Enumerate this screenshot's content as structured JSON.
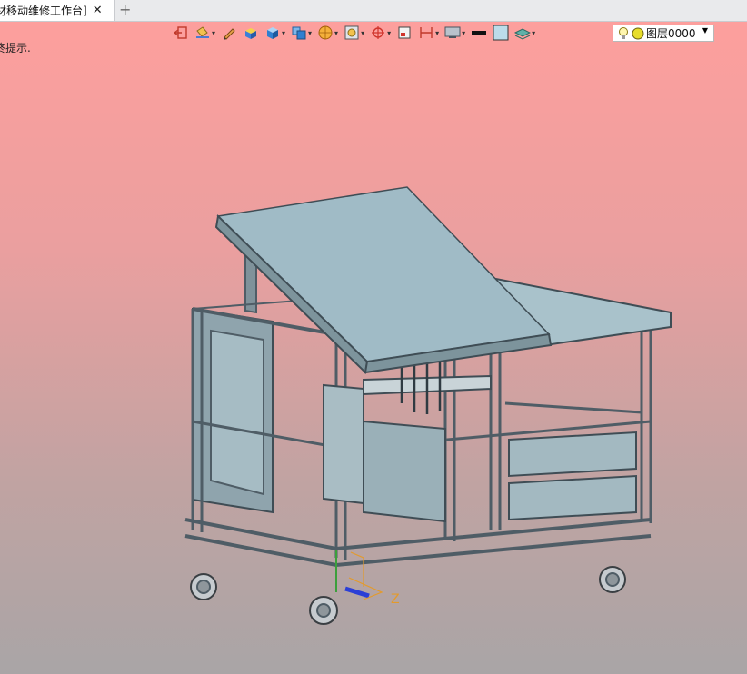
{
  "tab": {
    "title": "材移动维修工作台]",
    "close": "✕",
    "add": "+"
  },
  "hint": "终提示.",
  "layer": {
    "name": "图层0000",
    "dropdown": "▼"
  },
  "toolbar": {
    "dropdown_glyph": "▾",
    "icons": [
      "exit-sketch-icon",
      "paint-bucket-icon",
      "pencil-icon",
      "shaded-box-icon",
      "view-cube-icon",
      "view-mode-icon",
      "render-sphere-icon",
      "zoom-window-icon",
      "crosshair-icon",
      "frame-icon",
      "dimension-icon",
      "display-panel-icon",
      "line-color-icon",
      "fill-color-icon",
      "layer-stack-icon"
    ]
  },
  "axis": {
    "label": "Z"
  },
  "colors": {
    "accent": "#2b3fd6",
    "axis_orange": "#e39a2b",
    "table_top": "#9fb9c3",
    "frame": "#5d6b73"
  }
}
